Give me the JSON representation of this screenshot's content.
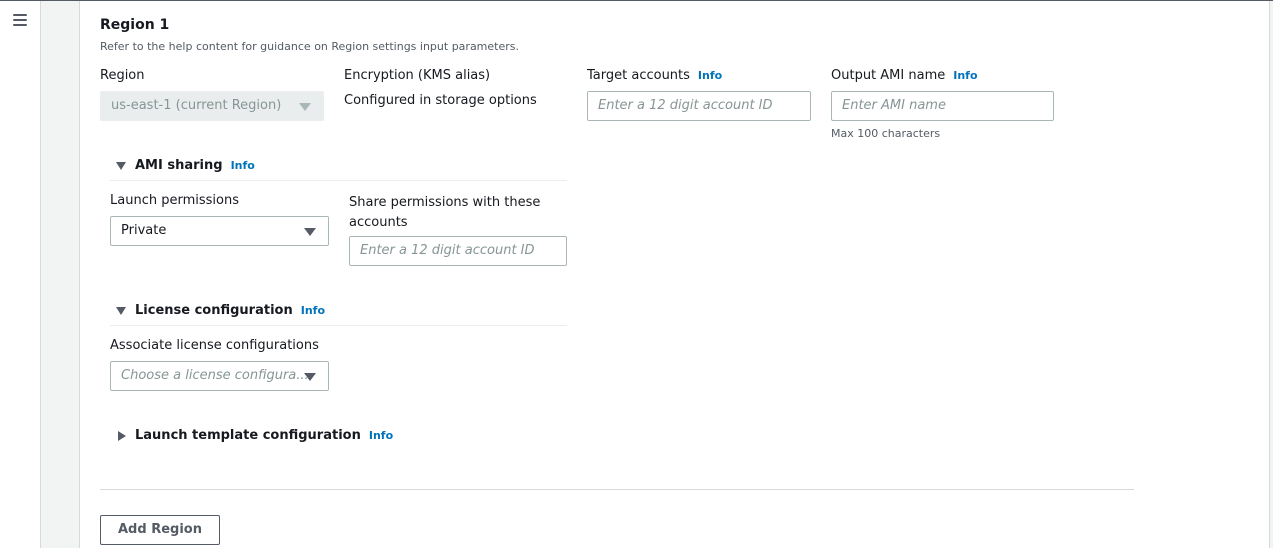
{
  "nav": {
    "menu_icon": "hamburger-menu-icon"
  },
  "region": {
    "title": "Region 1",
    "description": "Refer to the help content for guidance on Region settings input parameters.",
    "region_label": "Region",
    "region_value": "us-east-1 (current Region)",
    "encryption_label": "Encryption (KMS alias)",
    "encryption_value": "Configured in storage options",
    "target_accounts_label": "Target accounts",
    "target_accounts_info": "Info",
    "target_accounts_placeholder": "Enter a 12 digit account ID",
    "output_ami_label": "Output AMI name",
    "output_ami_info": "Info",
    "output_ami_placeholder": "Enter AMI name",
    "output_ami_hint": "Max 100 characters"
  },
  "ami_sharing": {
    "title": "AMI sharing",
    "info": "Info",
    "expanded": true,
    "launch_permissions_label": "Launch permissions",
    "launch_permissions_value": "Private",
    "share_label": "Share permissions with these accounts",
    "share_placeholder": "Enter a 12 digit account ID"
  },
  "license": {
    "title": "License configuration",
    "info": "Info",
    "expanded": true,
    "associate_label": "Associate license configurations",
    "associate_placeholder": "Choose a license configura..."
  },
  "launch_template": {
    "title": "Launch template configuration",
    "info": "Info",
    "expanded": false
  },
  "actions": {
    "add_region": "Add Region"
  }
}
